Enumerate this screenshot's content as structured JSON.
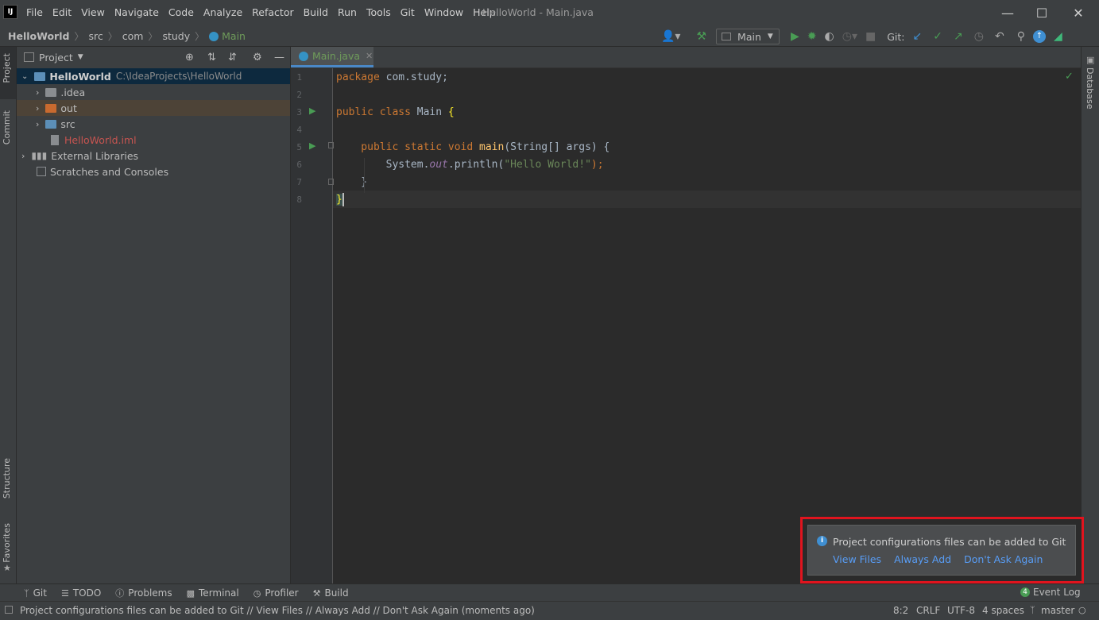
{
  "titlebar": {
    "logo": "IJ",
    "menu": [
      "File",
      "Edit",
      "View",
      "Navigate",
      "Code",
      "Analyze",
      "Refactor",
      "Build",
      "Run",
      "Tools",
      "Git",
      "Window",
      "Help"
    ],
    "window_title": "HelloWorld - Main.java",
    "controls": {
      "minimize": "minimize-icon",
      "maximize": "maximize-icon",
      "close": "close-icon"
    }
  },
  "navbar": {
    "breadcrumbs": [
      "HelloWorld",
      "src",
      "com",
      "study",
      "Main"
    ],
    "run_config": "Main",
    "git_label": "Git:"
  },
  "left_strip": {
    "tabs": [
      "Project",
      "Commit",
      "Structure",
      "Favorites"
    ]
  },
  "right_strip": {
    "tabs": [
      "Database"
    ]
  },
  "project": {
    "view_label": "Project",
    "root": {
      "name": "HelloWorld",
      "path": "C:\\IdeaProjects\\HelloWorld"
    },
    "items": [
      ".idea",
      "out",
      "src",
      "HelloWorld.iml"
    ],
    "external_libraries": "External Libraries",
    "scratches": "Scratches and Consoles"
  },
  "editor": {
    "tab": "Main.java",
    "line_numbers": [
      "1",
      "2",
      "3",
      "4",
      "5",
      "6",
      "7",
      "8"
    ],
    "code": {
      "l1_kw": "package",
      "l1_rest": " com.study;",
      "l3_kw": "public class",
      "l3_rest": " Main ",
      "l3_brace": "{",
      "l5_kw": "    public static void",
      "l5_fn": " main",
      "l5_rest": "(String[] args) {",
      "l6_a": "        System.",
      "l6_fld": "out",
      "l6_b": ".println(",
      "l6_str": "\"Hello World!\"",
      "l6_c": ");",
      "l7": "    }",
      "l8": "}"
    }
  },
  "bottom_tabs": [
    "Git",
    "TODO",
    "Problems",
    "Terminal",
    "Profiler",
    "Build"
  ],
  "event_log": {
    "count": "4",
    "label": "Event Log"
  },
  "notification": {
    "message": "Project configurations files can be added to Git",
    "actions": [
      "View Files",
      "Always Add",
      "Don't Ask Again"
    ]
  },
  "statusbar": {
    "message": "Project configurations files can be added to Git // View Files // Always Add // Don't Ask Again (moments ago)",
    "position": "8:2",
    "line_sep": "CRLF",
    "encoding": "UTF-8",
    "indent": "4 spaces",
    "branch": "master"
  },
  "colors": {
    "accent": "#589df6",
    "run_green": "#499c54",
    "highlight": "#e0141e",
    "folder_excluded": "#c96a2f",
    "folder_blue": "#5c8fb8"
  }
}
